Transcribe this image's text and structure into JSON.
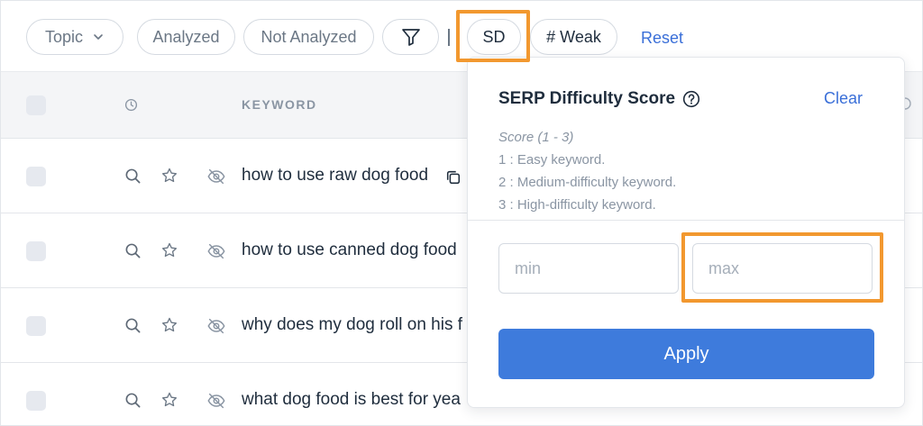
{
  "toolbar": {
    "topic_label": "Topic",
    "analyzed_label": "Analyzed",
    "not_analyzed_label": "Not Analyzed",
    "sd_label": "SD",
    "weak_label": "# Weak",
    "reset_label": "Reset"
  },
  "table": {
    "keyword_header": "KEYWORD",
    "rows": [
      {
        "keyword": "how to use raw dog food"
      },
      {
        "keyword": "how to use canned dog food"
      },
      {
        "keyword": "why does my dog roll on his f"
      },
      {
        "keyword": "what dog food is best for yea"
      }
    ]
  },
  "popover": {
    "title": "SERP Difficulty Score",
    "clear_label": "Clear",
    "score_range": "Score (1 - 3)",
    "levels": [
      "1 : Easy keyword.",
      "2 : Medium-difficulty keyword.",
      "3 : High-difficulty keyword."
    ],
    "min_placeholder": "min",
    "max_placeholder": "max",
    "apply_label": "Apply"
  },
  "colors": {
    "accent": "#3e7bdc",
    "highlight": "#f2982f",
    "link": "#3a6fd8"
  },
  "icons": [
    "chevron-down-icon",
    "filter-icon",
    "clock-icon",
    "search-icon",
    "star-icon",
    "eye-off-icon",
    "copy-icon",
    "help-circle-icon"
  ]
}
